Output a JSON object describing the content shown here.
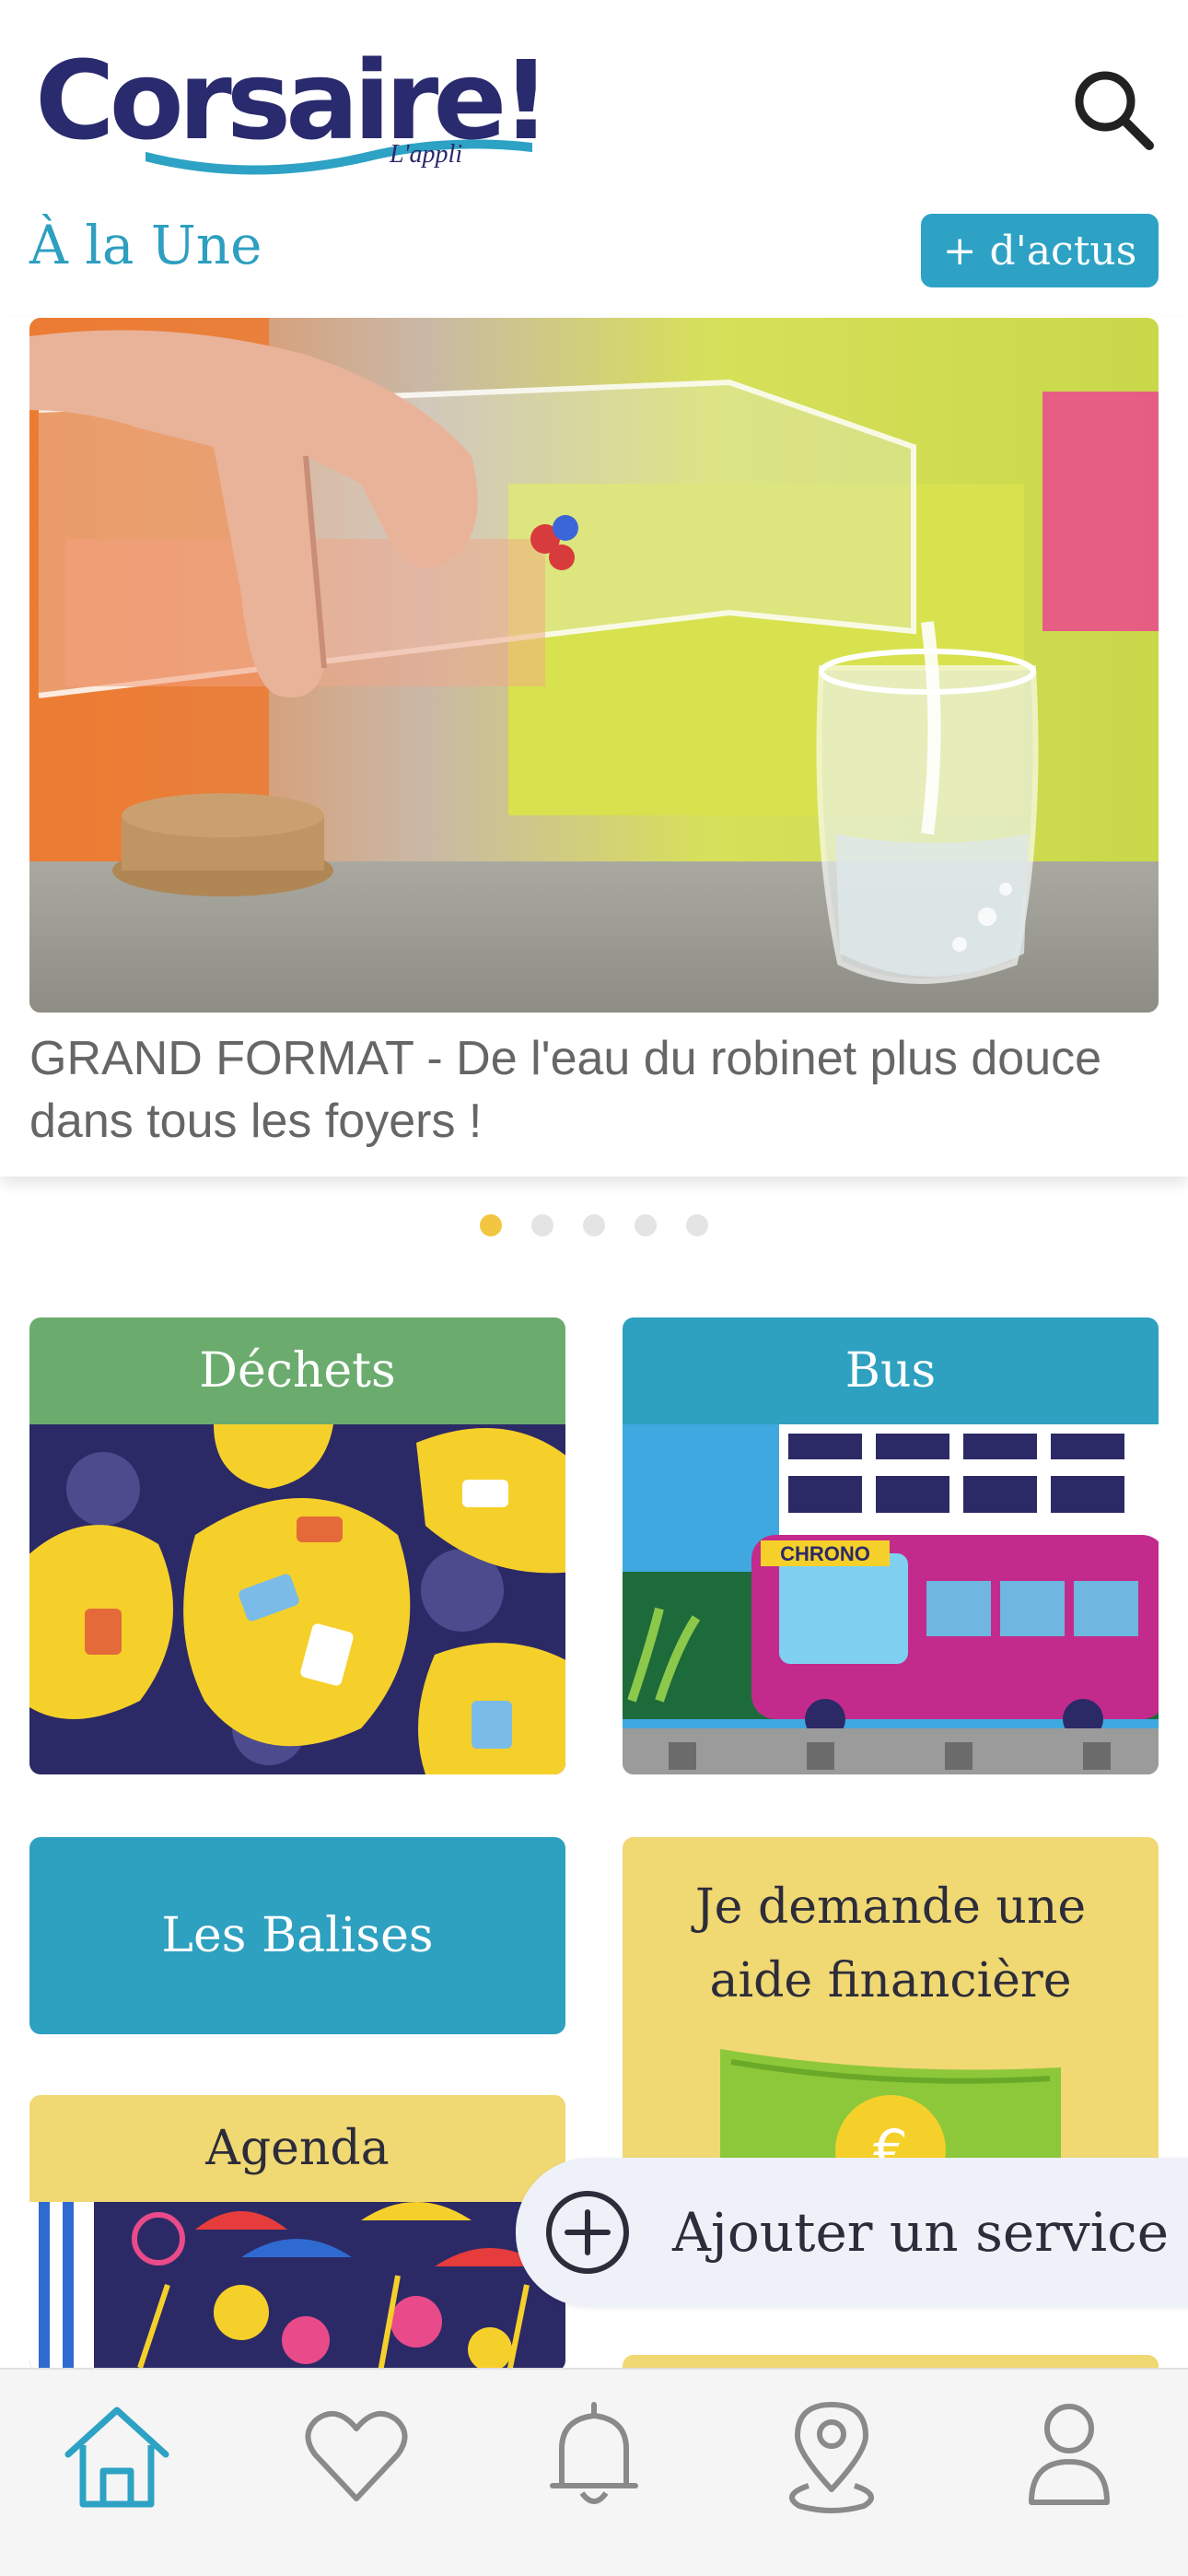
{
  "app": {
    "logo_text": "Corsaire!",
    "logo_subtitle": "L'appli"
  },
  "header": {
    "search_icon": "search-icon"
  },
  "featured": {
    "title": "À la Une",
    "more_button": "+ d'actus",
    "article_caption": "GRAND FORMAT - De l'eau du robinet plus douce dans tous les foyers !",
    "carousel": {
      "count": 5,
      "active_index": 0
    }
  },
  "services": {
    "cards": [
      {
        "title": "Déchets",
        "color": "#6bac6e"
      },
      {
        "title": "Bus",
        "color": "#2ea0c0"
      },
      {
        "title": "Les Balises",
        "color": "#2ea0c0"
      },
      {
        "title": "Je demande une aide financière",
        "color": "#f0d873"
      },
      {
        "title": "Agenda",
        "color": "#f0d873"
      }
    ],
    "bus_sign": "CHRONO",
    "add_service": "Ajouter un service"
  },
  "colors": {
    "accent": "#2da2c4",
    "dot_active": "#f2c640",
    "icon_active": "#2da2c4",
    "icon_inactive": "#8a8a8a"
  },
  "bottom_nav": {
    "items": [
      {
        "icon": "home-icon",
        "active": true
      },
      {
        "icon": "heart-icon",
        "active": false
      },
      {
        "icon": "bell-icon",
        "active": false
      },
      {
        "icon": "map-pin-icon",
        "active": false
      },
      {
        "icon": "user-icon",
        "active": false
      }
    ]
  }
}
